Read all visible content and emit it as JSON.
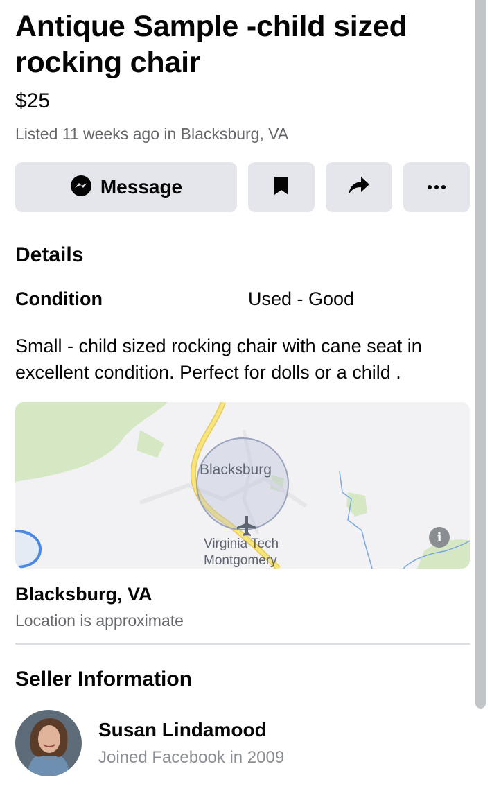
{
  "listing": {
    "title": "Antique Sample -child sized rocking chair",
    "price": "$25",
    "listed": "Listed 11 weeks ago in Blacksburg, VA"
  },
  "actions": {
    "message_label": "Message",
    "save_icon": "bookmark-icon",
    "share_icon": "share-arrow-icon",
    "more_icon": "more-dots-icon"
  },
  "details": {
    "heading": "Details",
    "condition_label": "Condition",
    "condition_value": "Used - Good",
    "description": "Small - child sized rocking chair with cane seat in excellent condition. Perfect for dolls or a child ."
  },
  "map": {
    "city_label": "Blacksburg",
    "airport_label_line1": "Virginia Tech",
    "airport_label_line2": "Montgomery",
    "info_icon": "info-icon"
  },
  "location": {
    "name": "Blacksburg, VA",
    "note": "Location is approximate"
  },
  "seller": {
    "heading": "Seller Information",
    "name": "Susan Lindamood",
    "joined": "Joined Facebook in 2009"
  },
  "colors": {
    "button_bg": "#e4e6eb",
    "secondary_text": "#65676b",
    "map_road": "#f2dd6c",
    "map_green": "#cfe6b8"
  }
}
